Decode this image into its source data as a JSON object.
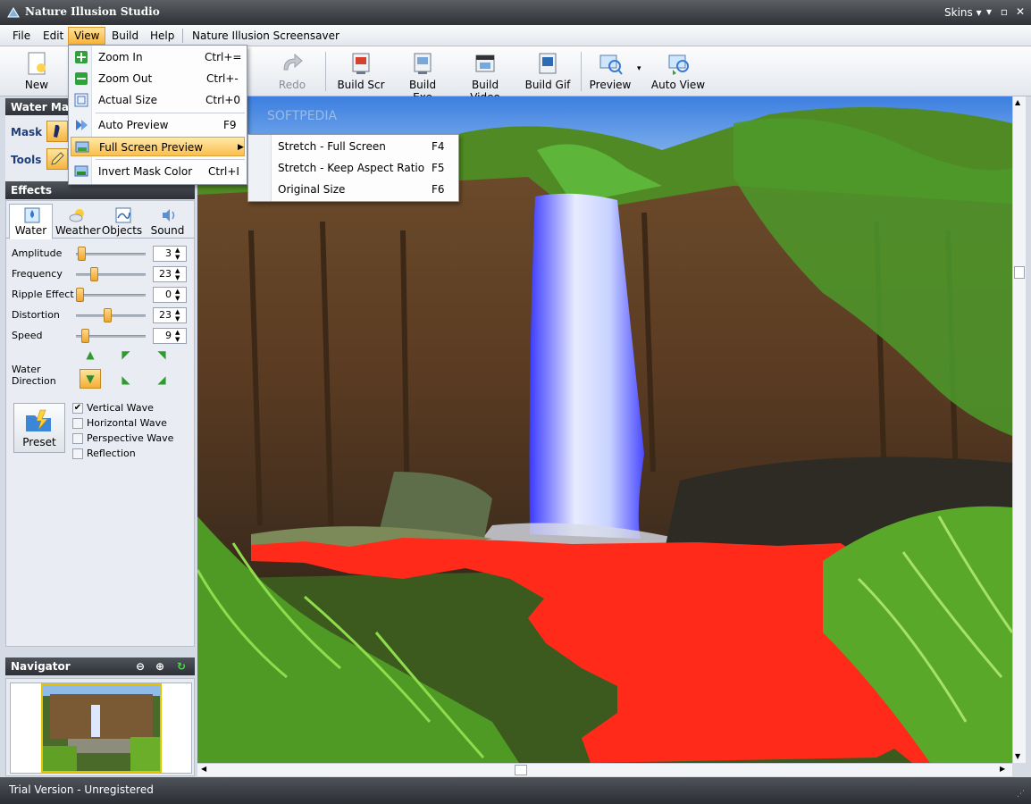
{
  "window": {
    "title": "Nature Illusion Studio",
    "skins_label": "Skins",
    "minimize": "▾",
    "maximize": "▫",
    "close": "✕"
  },
  "menubar": {
    "items": [
      "File",
      "Edit",
      "View",
      "Build",
      "Help",
      "Nature Illusion Screensaver"
    ]
  },
  "toolbar": {
    "new": "New",
    "redo": "Redo",
    "build_scr": "Build Scr",
    "build_exe": "Build Exe",
    "build_video": "Build Video",
    "build_gif": "Build Gif",
    "preview": "Preview",
    "auto_view": "Auto View"
  },
  "view_menu": {
    "items": [
      {
        "label": "Zoom In",
        "shortcut": "Ctrl+="
      },
      {
        "label": "Zoom Out",
        "shortcut": "Ctrl+-"
      },
      {
        "label": "Actual Size",
        "shortcut": "Ctrl+0"
      },
      {
        "label": "Auto Preview",
        "shortcut": "F9"
      },
      {
        "label": "Full Screen Preview",
        "shortcut": ""
      },
      {
        "label": "Invert Mask Color",
        "shortcut": "Ctrl+I"
      }
    ]
  },
  "fullscreen_submenu": {
    "items": [
      {
        "label": "Stretch - Full Screen",
        "shortcut": "F4"
      },
      {
        "label": "Stretch - Keep Aspect Ratio",
        "shortcut": "F5"
      },
      {
        "label": "Original Size",
        "shortcut": "F6"
      }
    ]
  },
  "water_mask": {
    "title": "Water Mask",
    "mask_label": "Mask",
    "tools_label": "Tools"
  },
  "effects": {
    "title": "Effects",
    "tabs": [
      "Water",
      "Weather",
      "Objects",
      "Sound"
    ],
    "params": [
      {
        "label": "Amplitude",
        "value": "3",
        "fraction": 0.03
      },
      {
        "label": "Frequency",
        "value": "23",
        "fraction": 0.23
      },
      {
        "label": "Ripple Effect",
        "value": "0",
        "fraction": 0.0
      },
      {
        "label": "Distortion",
        "value": "23",
        "fraction": 0.45
      },
      {
        "label": "Speed",
        "value": "9",
        "fraction": 0.09
      }
    ],
    "direction_label_1": "Water",
    "direction_label_2": "Direction",
    "preset_label": "Preset",
    "checkboxes": [
      {
        "label": "Vertical Wave",
        "checked": true
      },
      {
        "label": "Horizontal Wave",
        "checked": false
      },
      {
        "label": "Perspective Wave",
        "checked": false
      },
      {
        "label": "Reflection",
        "checked": false
      }
    ]
  },
  "navigator": {
    "title": "Navigator"
  },
  "status": {
    "text": "Trial Version - Unregistered"
  },
  "colors": {
    "mask_red": "#ff2a1a",
    "accent_orange": "#f5b440",
    "header_dark": "#2d3036"
  }
}
